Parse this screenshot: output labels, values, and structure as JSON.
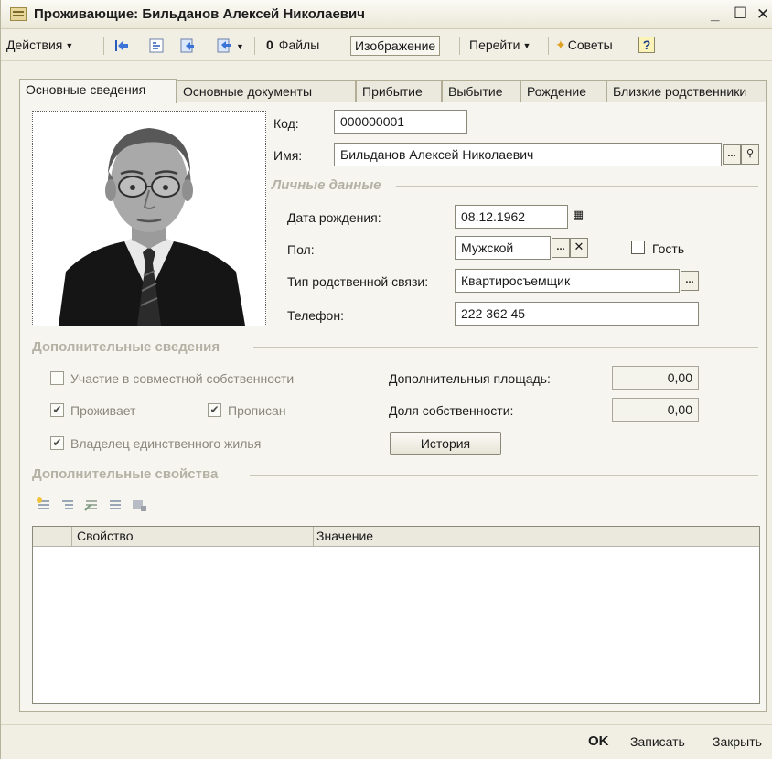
{
  "window": {
    "title": "Проживающие: Бильданов Алексей Николаевич",
    "minimize_label": "_",
    "maximize_label": "☐",
    "close_label": "✕"
  },
  "toolbar": {
    "actions_label": "Действия",
    "files_label": "Файлы",
    "image_label": "Изображение",
    "goto_label": "Перейти",
    "tips_label": "Советы",
    "help_label": "?"
  },
  "tabs": [
    {
      "label": "Основные сведения",
      "active": true
    },
    {
      "label": "Основные документы",
      "active": false
    },
    {
      "label": "Прибытие",
      "active": false
    },
    {
      "label": "Выбытие",
      "active": false
    },
    {
      "label": "Рождение",
      "active": false
    },
    {
      "label": "Близкие родственники",
      "active": false
    }
  ],
  "form": {
    "code_label": "Код:",
    "code_value": "000000001",
    "name_label": "Имя:",
    "name_value": "Бильданов Алексей Николаевич",
    "personal_section": "Личные данные",
    "birth_date_label": "Дата рождения:",
    "birth_date_value": "08.12.1962",
    "gender_label": "Пол:",
    "gender_value": "Мужской",
    "guest_label": "Гость",
    "relation_label": "Тип родственной связи:",
    "relation_value": "Квартиросъемщик",
    "phone_label": "Телефон:",
    "phone_value": "222 362 45"
  },
  "additional": {
    "section_title": "Дополнительные сведения",
    "joint_ownership_label": "Участие в совместной собственности",
    "joint_ownership_checked": false,
    "lives_label": "Проживает",
    "lives_checked": true,
    "registered_label": "Прописан",
    "registered_checked": true,
    "sole_owner_label": "Владелец единственного жилья",
    "sole_owner_checked": true,
    "extra_area_label": "Дополнительныя площадь:",
    "extra_area_value": "0,00",
    "ownership_share_label": "Доля собственности:",
    "ownership_share_value": "0,00",
    "history_button": "История"
  },
  "properties": {
    "section_title": "Дополнительные свойства",
    "columns": [
      "Свойство",
      "Значение"
    ],
    "rows": []
  },
  "footer": {
    "ok_label": "OK",
    "save_label": "Записать",
    "close_label": "Закрыть"
  },
  "colors": {
    "window_bg": "#f1efe4",
    "panel_bg": "#f6f5ef",
    "section_title": "#b4b2a5"
  }
}
